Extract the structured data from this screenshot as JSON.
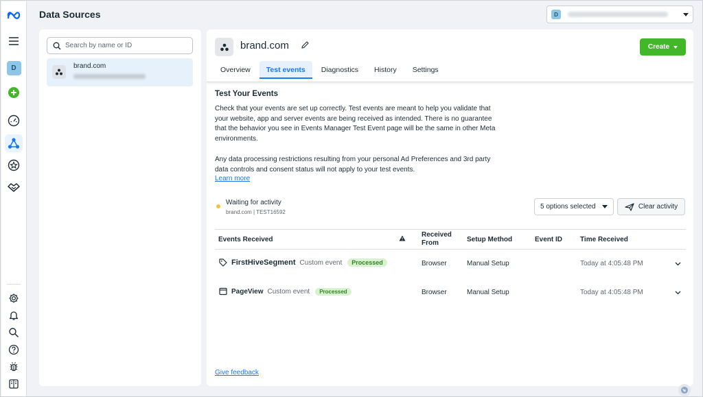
{
  "app": {
    "title": "Data Sources"
  },
  "account": {
    "badge": "D"
  },
  "rail": {
    "avatar_letter": "D",
    "icons": [
      "meta-logo-icon",
      "menu-icon",
      "avatar",
      "add-icon",
      "gauge-icon",
      "data-sources-icon",
      "star-badge-icon",
      "handshake-icon",
      "settings-icon",
      "notifications-icon",
      "search-icon",
      "help-icon",
      "bug-icon",
      "panel-icon"
    ]
  },
  "sidebar": {
    "search_placeholder": "Search by name or ID",
    "items": [
      {
        "name": "brand.com"
      }
    ]
  },
  "main": {
    "title": "brand.com",
    "create_label": "Create",
    "tabs": [
      {
        "label": "Overview"
      },
      {
        "label": "Test events",
        "active": true
      },
      {
        "label": "Diagnostics"
      },
      {
        "label": "History"
      },
      {
        "label": "Settings"
      }
    ],
    "section_title": "Test Your Events",
    "para1": "Check that your events are set up correctly. Test events are meant to help you validate that your website, app and server events are being received as intended. There is no guarantee that the behavior you see in Events Manager Test Event page will be the same in other Meta environments.",
    "para2": "Any data processing restrictions resulting from your personal Ad Preferences and 3rd party data controls and consent status will not apply to your test events.",
    "learn_more": "Learn more",
    "status": {
      "title": "Waiting for activity",
      "subtitle": "brand.com  | TEST16592"
    },
    "options_label": "5 options selected",
    "clear_label": "Clear activity",
    "table": {
      "headers": {
        "events": "Events Received",
        "received_from": "Received From",
        "setup_method": "Setup Method",
        "event_id": "Event ID",
        "time": "Time Received"
      },
      "rows": [
        {
          "name": "FirstHiveSegment",
          "type": "Custom event",
          "status": "Processed",
          "from": "Browser",
          "setup": "Manual Setup",
          "event_id": "",
          "time": "Today at 4:05:48 PM"
        },
        {
          "name": "PageView",
          "type": "Custom event",
          "status": "Processed",
          "from": "Browser",
          "setup": "Manual Setup",
          "event_id": "",
          "time": "Today at 4:05:48 PM"
        }
      ]
    },
    "feedback": "Give feedback"
  },
  "colors": {
    "accent": "#1877f2",
    "create": "#42b72a",
    "status_pending": "#f5c33b",
    "processed_bg": "#d8f2cf"
  }
}
